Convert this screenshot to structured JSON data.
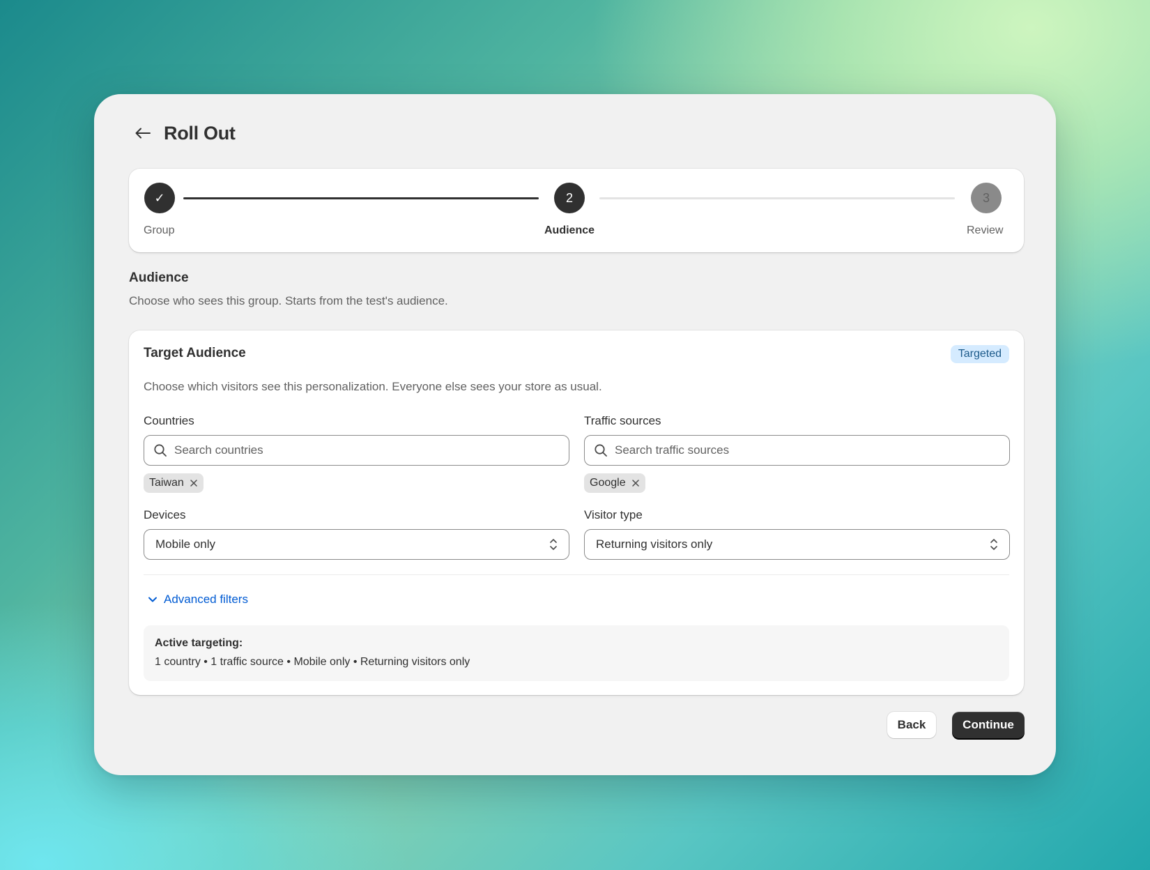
{
  "header": {
    "title": "Roll Out"
  },
  "stepper": {
    "steps": [
      {
        "number": "",
        "label": "Group",
        "state": "complete"
      },
      {
        "number": "2",
        "label": "Audience",
        "state": "current"
      },
      {
        "number": "3",
        "label": "Review",
        "state": "upcoming"
      }
    ],
    "check_glyph": "✓"
  },
  "section": {
    "title": "Audience",
    "description": "Choose who sees this group. Starts from the test's audience."
  },
  "target": {
    "title": "Target Audience",
    "badge": "Targeted",
    "description": "Choose which visitors see this personalization. Everyone else sees your store as usual.",
    "countries": {
      "label": "Countries",
      "placeholder": "Search countries",
      "tags": [
        "Taiwan"
      ]
    },
    "traffic_sources": {
      "label": "Traffic sources",
      "placeholder": "Search traffic sources",
      "tags": [
        "Google"
      ]
    },
    "devices": {
      "label": "Devices",
      "value": "Mobile only"
    },
    "visitor_type": {
      "label": "Visitor type",
      "value": "Returning visitors only"
    },
    "advanced_filters": "Advanced filters",
    "summary": {
      "title": "Active targeting:",
      "text": "1 country • 1 traffic source • Mobile only • Returning visitors only"
    }
  },
  "actions": {
    "back": "Back",
    "continue": "Continue"
  },
  "colors": {
    "primary": "#303030",
    "link": "#005bd3",
    "badge_bg": "#d5ebff",
    "badge_text": "#1c5a8a",
    "upcoming_step": "#8a8a8a"
  }
}
